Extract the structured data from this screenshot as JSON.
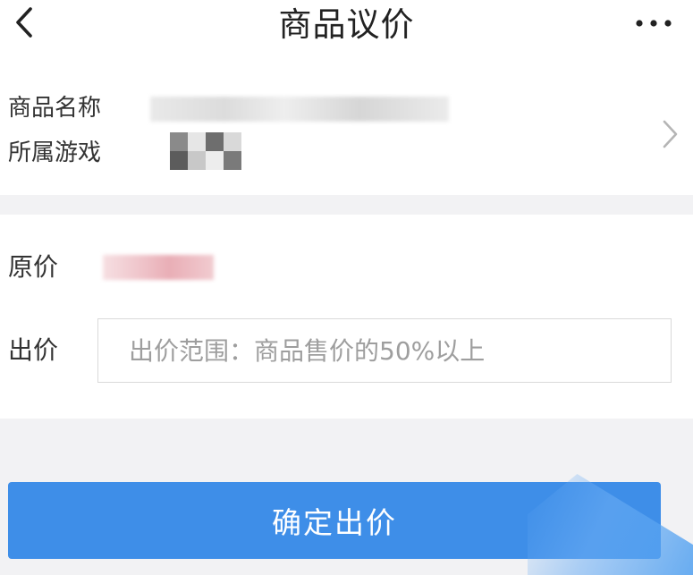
{
  "header": {
    "title": "商品议价",
    "back_icon": "chevron-left-icon",
    "more_icon": "more-horizontal-icon"
  },
  "product": {
    "name_label": "商品名称",
    "game_label": "所属游戏",
    "chevron_icon": "chevron-right-icon"
  },
  "pricing": {
    "original_label": "原价",
    "bid_label": "出价",
    "bid_placeholder": "出价范围：商品售价的50%以上",
    "bid_value": ""
  },
  "actions": {
    "confirm_label": "确定出价"
  },
  "colors": {
    "accent": "#3e8ee8",
    "background": "#f2f2f4",
    "text": "#333333",
    "placeholder": "#9e9e9e"
  }
}
